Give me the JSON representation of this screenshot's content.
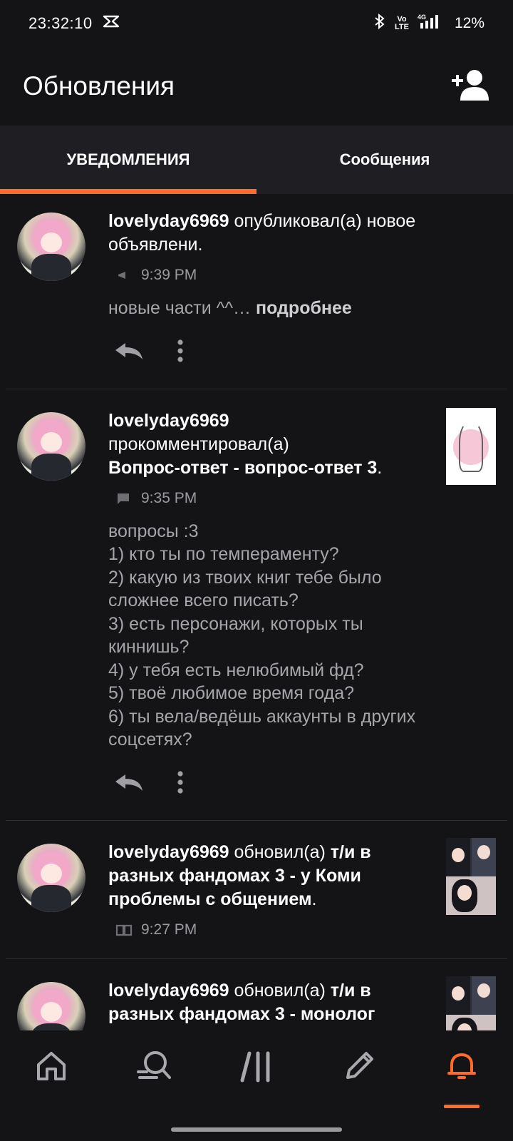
{
  "status_bar": {
    "time": "23:32:10",
    "app_icon": "capcut-icon",
    "network_volte": "Vo\nLTE",
    "network_type": "4G",
    "battery_percent": "12%"
  },
  "header": {
    "title": "Обновления",
    "add_user_icon": "add-user-icon"
  },
  "tabs": [
    {
      "label": "УВЕДОМЛЕНИЯ",
      "active": true
    },
    {
      "label": "Сообщения",
      "active": false
    }
  ],
  "notifications": [
    {
      "user": "lovelyday6969",
      "action": " опубликовал(а) новое объявлени.",
      "meta_icon": "megaphone-icon",
      "time": "9:39 PM",
      "body": "новые части ^^… ",
      "more": "подробнее"
    },
    {
      "user": "lovelyday6969",
      "action": "прокомментировал(а)",
      "work": "Вопрос-ответ - вопрос-ответ 3",
      "work_suffix": ".",
      "meta_icon": "comment-icon",
      "time": "9:35 PM",
      "body": "вопросы :3\n1) кто ты по темпераменту?\n2) какую из твоих книг тебе было сложнее всего писать?\n3) есть персонажи, которых ты киннишь?\n4) у тебя есть нелюбимый фд?\n5) твоё любимое время года?\n6) ты вела/ведёшь аккаунты в других соцсетях?"
    },
    {
      "user": "lovelyday6969",
      "action": " обновил(а) ",
      "work": "т/и в разных фандомах 3 - у Коми проблемы с общением",
      "work_suffix": ".",
      "meta_icon": "book-icon",
      "time": "9:27 PM"
    },
    {
      "user": "lovelyday6969",
      "action": " обновил(а) ",
      "work": "т/и в разных фандомах 3 - монолог"
    }
  ],
  "bottom_nav": [
    {
      "icon": "home-icon",
      "active": false
    },
    {
      "icon": "search-icon",
      "active": false
    },
    {
      "icon": "library-icon",
      "active": false
    },
    {
      "icon": "write-icon",
      "active": false
    },
    {
      "icon": "bell-icon",
      "active": true
    }
  ],
  "colors": {
    "accent": "#ff6b2b",
    "background": "#141316",
    "tab_bar": "#1f1e22",
    "secondary_text": "#9b9a9f"
  }
}
